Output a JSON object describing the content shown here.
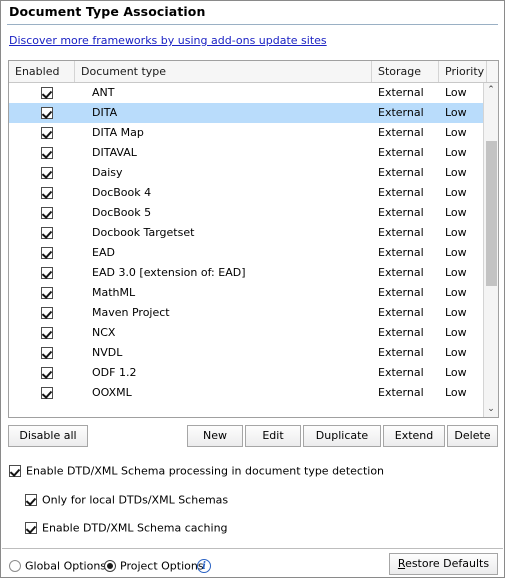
{
  "page_title": "Document Type Association",
  "link": {
    "text": "Discover more frameworks by using add-ons update sites"
  },
  "table": {
    "columns": [
      "Enabled",
      "Document type",
      "Storage",
      "Priority"
    ],
    "rows": [
      {
        "enabled": true,
        "name": "ANT",
        "storage": "External",
        "priority": "Low",
        "selected": false
      },
      {
        "enabled": true,
        "name": "DITA",
        "storage": "External",
        "priority": "Low",
        "selected": true
      },
      {
        "enabled": true,
        "name": "DITA Map",
        "storage": "External",
        "priority": "Low",
        "selected": false
      },
      {
        "enabled": true,
        "name": "DITAVAL",
        "storage": "External",
        "priority": "Low",
        "selected": false
      },
      {
        "enabled": true,
        "name": "Daisy",
        "storage": "External",
        "priority": "Low",
        "selected": false
      },
      {
        "enabled": true,
        "name": "DocBook 4",
        "storage": "External",
        "priority": "Low",
        "selected": false
      },
      {
        "enabled": true,
        "name": "DocBook 5",
        "storage": "External",
        "priority": "Low",
        "selected": false
      },
      {
        "enabled": true,
        "name": "Docbook Targetset",
        "storage": "External",
        "priority": "Low",
        "selected": false
      },
      {
        "enabled": true,
        "name": "EAD",
        "storage": "External",
        "priority": "Low",
        "selected": false
      },
      {
        "enabled": true,
        "name": "EAD 3.0 [extension of: EAD]",
        "storage": "External",
        "priority": "Low",
        "selected": false
      },
      {
        "enabled": true,
        "name": "MathML",
        "storage": "External",
        "priority": "Low",
        "selected": false
      },
      {
        "enabled": true,
        "name": "Maven Project",
        "storage": "External",
        "priority": "Low",
        "selected": false
      },
      {
        "enabled": true,
        "name": "NCX",
        "storage": "External",
        "priority": "Low",
        "selected": false
      },
      {
        "enabled": true,
        "name": "NVDL",
        "storage": "External",
        "priority": "Low",
        "selected": false
      },
      {
        "enabled": true,
        "name": "ODF 1.2",
        "storage": "External",
        "priority": "Low",
        "selected": false
      },
      {
        "enabled": true,
        "name": "OOXML",
        "storage": "External",
        "priority": "Low",
        "selected": false
      },
      {
        "enabled": true,
        "name": "",
        "storage": "",
        "priority": "",
        "selected": false
      }
    ],
    "scrollbar": {
      "up_arrow": "⌃",
      "down_arrow": "⌄"
    }
  },
  "buttons": {
    "disable_all": "Disable all",
    "new": "New",
    "edit": "Edit",
    "duplicate": "Duplicate",
    "extend": "Extend",
    "delete": "Delete"
  },
  "options": [
    {
      "label": "Enable DTD/XML Schema processing in document type detection",
      "checked": true
    },
    {
      "label": "Only for local DTDs/XML Schemas",
      "checked": true
    },
    {
      "label": "Enable DTD/XML Schema caching",
      "checked": true
    }
  ],
  "footer": {
    "global_options": "Global Options",
    "project_options": "Project Options",
    "global_selected": false,
    "project_selected": true,
    "info_icon_glyph": "i",
    "restore_defaults_mnemonic": "R",
    "restore_defaults_rest": "estore Defaults"
  },
  "colors": {
    "selection": "#b9dcfb",
    "link": "#1b22c4",
    "title_rule": "#9ab0c4",
    "info": "#2a62c4"
  }
}
